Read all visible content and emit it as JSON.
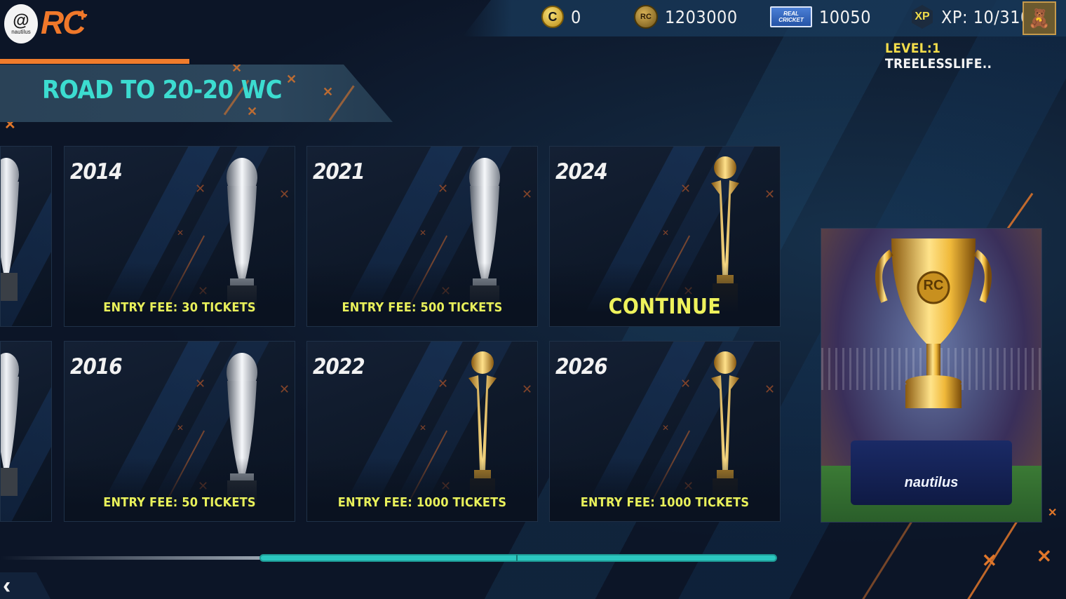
{
  "brand": {
    "logo_small_text": "nautilus",
    "app_logo": "RC",
    "app_logo_plus": "+"
  },
  "currencies": {
    "coins": "0",
    "rc_coins": "1203000",
    "tickets": "10050",
    "xp_badge": "XP",
    "xp": "XP: 10/310",
    "ticket_badge_text": "REAL CRICKET"
  },
  "player": {
    "level_label": "LEVEL:1",
    "name": "TREELESSLIFE.."
  },
  "section": {
    "title": "ROAD TO 20-20 WC"
  },
  "cards": [
    {
      "year": "2014",
      "label": "ENTRY FEE: 30 TICKETS",
      "trophy": "silver"
    },
    {
      "year": "2021",
      "label": "ENTRY FEE: 500 TICKETS",
      "trophy": "silver"
    },
    {
      "year": "2024",
      "label": "CONTINUE",
      "trophy": "gold"
    },
    {
      "year": "2016",
      "label": "ENTRY FEE: 50 TICKETS",
      "trophy": "silver"
    },
    {
      "year": "2022",
      "label": "ENTRY FEE: 1000 TICKETS",
      "trophy": "gold"
    },
    {
      "year": "2026",
      "label": "ENTRY FEE: 1000 TICKETS",
      "trophy": "gold"
    }
  ],
  "feature": {
    "trophy_emblem": "RC",
    "brand": "nautilus"
  },
  "scroll": {
    "progress": 0.33
  },
  "colors": {
    "accent_teal": "#3cdcd0",
    "accent_orange": "#f07c2c",
    "fee_yellow": "#e8f05a"
  },
  "icons": {
    "back": "chevron-left-icon",
    "coin": "coin-icon",
    "rc_coin": "rc-coin-icon",
    "ticket": "ticket-icon",
    "xp": "xp-badge-icon",
    "avatar": "teddy-bear-avatar"
  }
}
